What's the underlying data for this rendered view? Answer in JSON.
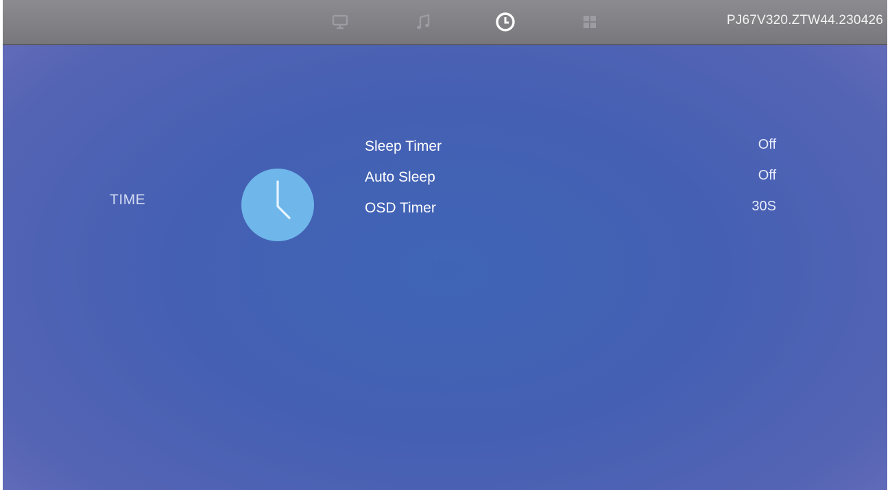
{
  "header": {
    "tabs": [
      {
        "icon": "monitor-icon",
        "active": false
      },
      {
        "icon": "music-note-icon",
        "active": false
      },
      {
        "icon": "clock-icon",
        "active": true
      },
      {
        "icon": "apps-grid-icon",
        "active": false
      }
    ],
    "firmware_version": "PJ67V320.ZTW44.230426"
  },
  "category": {
    "label": "TIME",
    "icon": "clock-icon"
  },
  "menu": {
    "items": [
      {
        "label": "Sleep Timer",
        "value": "Off"
      },
      {
        "label": "Auto Sleep",
        "value": "Off"
      },
      {
        "label": "OSD Timer",
        "value": "30S"
      }
    ]
  },
  "colors": {
    "background": "#4560b3",
    "topbar": "#808085",
    "clock_circle": "#6fb7ea"
  }
}
